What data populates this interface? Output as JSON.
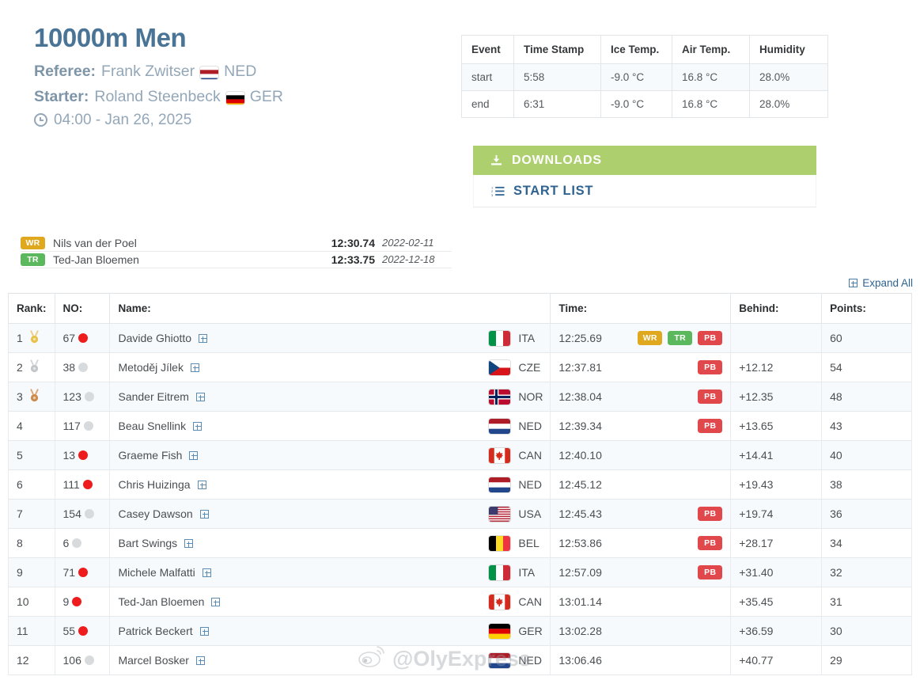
{
  "header": {
    "event_title": "10000m Men",
    "referee_role": "Referee:",
    "referee_name": "Frank Zwitser",
    "referee_nat": "NED",
    "starter_role": "Starter:",
    "starter_name": "Roland Steenbeck",
    "starter_nat": "GER",
    "datetime": "04:00 - Jan 26, 2025",
    "clock_icon": "clock-icon"
  },
  "conditions": {
    "columns": [
      "Event",
      "Time Stamp",
      "Ice Temp.",
      "Air Temp.",
      "Humidity"
    ],
    "rows": [
      {
        "event": "start",
        "timestamp": "5:58",
        "ice": "-9.0 °C",
        "air": "16.8 °C",
        "humidity": "28.0%"
      },
      {
        "event": "end",
        "timestamp": "6:31",
        "ice": "-9.0 °C",
        "air": "16.8 °C",
        "humidity": "28.0%"
      }
    ]
  },
  "actions": {
    "downloads_label": "DOWNLOADS",
    "downloads_icon": "download-icon",
    "downloads_color": "#adcf6e",
    "start_list_label": "START LIST",
    "start_list_icon": "ordered-list-icon",
    "start_list_color": "#2f6391"
  },
  "records": [
    {
      "badge": "WR",
      "badge_type": "wr",
      "badge_color": "#e0a81f",
      "name": "Nils van der Poel",
      "time": "12:30.74",
      "date": "2022-02-11"
    },
    {
      "badge": "TR",
      "badge_type": "tr",
      "badge_color": "#5cb85c",
      "name": "Ted-Jan Bloemen",
      "time": "12:33.75",
      "date": "2022-12-18"
    }
  ],
  "expand_all": {
    "label": "Expand All",
    "icon": "plus-box-icon"
  },
  "results": {
    "columns": [
      "Rank:",
      "NO:",
      "Name:",
      "Time:",
      "Behind:",
      "Points:"
    ],
    "rows": [
      {
        "rank": "1",
        "medal": "gold",
        "no": "67",
        "lane": "inner",
        "name": "Davide Ghiotto",
        "nat": "ITA",
        "flag": "ITA",
        "time": "12:25.69",
        "badges": [
          "WR",
          "TR",
          "PB"
        ],
        "behind": "",
        "points": "60"
      },
      {
        "rank": "2",
        "medal": "silver",
        "no": "38",
        "lane": "outer",
        "name": "Metoděj Jílek",
        "nat": "CZE",
        "flag": "CZE",
        "time": "12:37.81",
        "badges": [
          "PB"
        ],
        "behind": "+12.12",
        "points": "54"
      },
      {
        "rank": "3",
        "medal": "bronze",
        "no": "123",
        "lane": "outer",
        "name": "Sander Eitrem",
        "nat": "NOR",
        "flag": "NOR",
        "time": "12:38.04",
        "badges": [
          "PB"
        ],
        "behind": "+12.35",
        "points": "48"
      },
      {
        "rank": "4",
        "medal": "",
        "no": "117",
        "lane": "outer",
        "name": "Beau Snellink",
        "nat": "NED",
        "flag": "NED",
        "time": "12:39.34",
        "badges": [
          "PB"
        ],
        "behind": "+13.65",
        "points": "43"
      },
      {
        "rank": "5",
        "medal": "",
        "no": "13",
        "lane": "inner",
        "name": "Graeme Fish",
        "nat": "CAN",
        "flag": "CAN",
        "time": "12:40.10",
        "badges": [],
        "behind": "+14.41",
        "points": "40"
      },
      {
        "rank": "6",
        "medal": "",
        "no": "111",
        "lane": "inner",
        "name": "Chris Huizinga",
        "nat": "NED",
        "flag": "NED",
        "time": "12:45.12",
        "badges": [],
        "behind": "+19.43",
        "points": "38"
      },
      {
        "rank": "7",
        "medal": "",
        "no": "154",
        "lane": "outer",
        "name": "Casey Dawson",
        "nat": "USA",
        "flag": "USA",
        "time": "12:45.43",
        "badges": [
          "PB"
        ],
        "behind": "+19.74",
        "points": "36"
      },
      {
        "rank": "8",
        "medal": "",
        "no": "6",
        "lane": "outer",
        "name": "Bart Swings",
        "nat": "BEL",
        "flag": "BEL",
        "time": "12:53.86",
        "badges": [
          "PB"
        ],
        "behind": "+28.17",
        "points": "34"
      },
      {
        "rank": "9",
        "medal": "",
        "no": "71",
        "lane": "inner",
        "name": "Michele Malfatti",
        "nat": "ITA",
        "flag": "ITA",
        "time": "12:57.09",
        "badges": [
          "PB"
        ],
        "behind": "+31.40",
        "points": "32"
      },
      {
        "rank": "10",
        "medal": "",
        "no": "9",
        "lane": "inner",
        "name": "Ted-Jan Bloemen",
        "nat": "CAN",
        "flag": "CAN",
        "time": "13:01.14",
        "badges": [],
        "behind": "+35.45",
        "points": "31"
      },
      {
        "rank": "11",
        "medal": "",
        "no": "55",
        "lane": "inner",
        "name": "Patrick Beckert",
        "nat": "GER",
        "flag": "GER",
        "time": "13:02.28",
        "badges": [],
        "behind": "+36.59",
        "points": "30"
      },
      {
        "rank": "12",
        "medal": "",
        "no": "106",
        "lane": "outer",
        "name": "Marcel Bosker",
        "nat": "NED",
        "flag": "NED",
        "time": "13:06.46",
        "badges": [],
        "behind": "+40.77",
        "points": "29"
      }
    ]
  },
  "watermark": {
    "text": "@OlyExpress",
    "icon": "weibo-logo-icon"
  }
}
